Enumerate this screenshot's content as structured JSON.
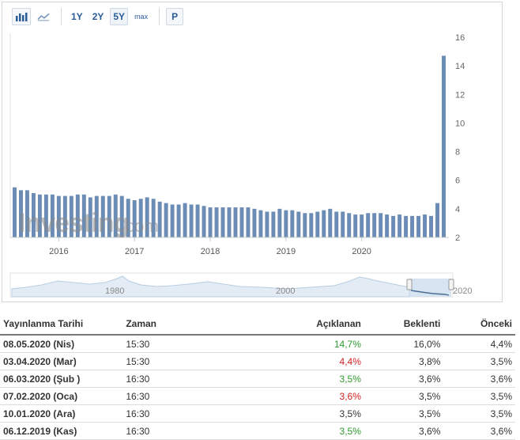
{
  "toolbar": {
    "bar_icon": "bar-chart-icon",
    "line_icon": "line-chart-icon",
    "ranges": [
      "1Y",
      "2Y",
      "5Y",
      "max"
    ],
    "active_range": "5Y",
    "p_label": "P"
  },
  "watermark": {
    "brand": "Investing",
    "suffix": ".com"
  },
  "chart_data": {
    "type": "bar",
    "ylim": [
      2,
      16
    ],
    "y_ticks": [
      2,
      4,
      6,
      8,
      10,
      12,
      14,
      16
    ],
    "x_tick_labels": [
      "2016",
      "2017",
      "2018",
      "2019",
      "2020"
    ],
    "bar_color": "#6a8cb5",
    "values": [
      5.5,
      5.3,
      5.3,
      5.1,
      5.0,
      5.0,
      5.0,
      4.9,
      4.9,
      4.9,
      5.0,
      5.0,
      4.8,
      4.9,
      4.9,
      4.9,
      5.0,
      4.9,
      4.7,
      4.6,
      4.7,
      4.8,
      4.7,
      4.5,
      4.4,
      4.3,
      4.3,
      4.4,
      4.3,
      4.3,
      4.2,
      4.1,
      4.1,
      4.1,
      4.1,
      4.1,
      4.1,
      4.1,
      4.0,
      3.9,
      3.8,
      3.8,
      4.0,
      3.9,
      3.9,
      3.8,
      3.7,
      3.7,
      3.8,
      3.9,
      4.0,
      3.8,
      3.8,
      3.7,
      3.6,
      3.6,
      3.7,
      3.7,
      3.7,
      3.6,
      3.5,
      3.6,
      3.5,
      3.5,
      3.5,
      3.6,
      3.5,
      4.4,
      14.7
    ],
    "navigator": {
      "labels": [
        "1980",
        "2000",
        "2020"
      ]
    }
  },
  "table": {
    "headers": [
      "Yayınlanma Tarihi",
      "Zaman",
      "Açıklanan",
      "Beklenti",
      "Önceki"
    ],
    "rows": [
      {
        "date": "08.05.2020 (Nis)",
        "time": "15:30",
        "actual": "14,7%",
        "forecast": "16,0%",
        "previous": "4,4%",
        "actual_color": "green"
      },
      {
        "date": "03.04.2020 (Mar)",
        "time": "15:30",
        "actual": "4,4%",
        "forecast": "3,8%",
        "previous": "3,5%",
        "actual_color": "red"
      },
      {
        "date": "06.03.2020 (Şub )",
        "time": "16:30",
        "actual": "3,5%",
        "forecast": "3,6%",
        "previous": "3,6%",
        "actual_color": "green"
      },
      {
        "date": "07.02.2020 (Oca)",
        "time": "16:30",
        "actual": "3,6%",
        "forecast": "3,5%",
        "previous": "3,5%",
        "actual_color": "red"
      },
      {
        "date": "10.01.2020 (Ara)",
        "time": "16:30",
        "actual": "3,5%",
        "forecast": "3,5%",
        "previous": "3,5%",
        "actual_color": "none"
      },
      {
        "date": "06.12.2019 (Kas)",
        "time": "16:30",
        "actual": "3,5%",
        "forecast": "3,6%",
        "previous": "3,6%",
        "actual_color": "green"
      }
    ]
  }
}
